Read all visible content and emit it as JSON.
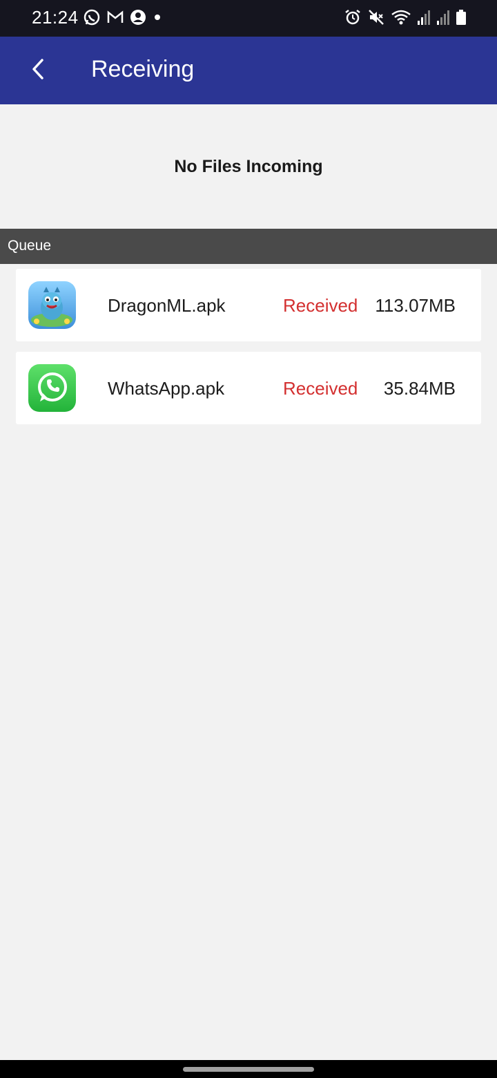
{
  "status_bar": {
    "time": "21:24",
    "left_icons": [
      "whatsapp-icon",
      "gmail-icon",
      "account-icon",
      "dot-icon"
    ],
    "right_icons": [
      "alarm-icon",
      "mute-icon",
      "wifi-icon",
      "signal-icon",
      "signal-icon-2",
      "battery-icon"
    ]
  },
  "app_bar": {
    "back_icon": "back-arrow-icon",
    "title": "Receiving",
    "color": "#2b3594"
  },
  "incoming": {
    "message": "No Files Incoming"
  },
  "queue": {
    "label": "Queue",
    "items": [
      {
        "icon": "dragonml-app-icon",
        "name": "DragonML.apk",
        "status": "Received",
        "size": "113.07MB"
      },
      {
        "icon": "whatsapp-app-icon",
        "name": "WhatsApp.apk",
        "status": "Received",
        "size": "35.84MB"
      }
    ]
  },
  "colors": {
    "status_received": "#d32f2f",
    "queue_header": "#4a4a4a",
    "background": "#f2f2f2"
  }
}
